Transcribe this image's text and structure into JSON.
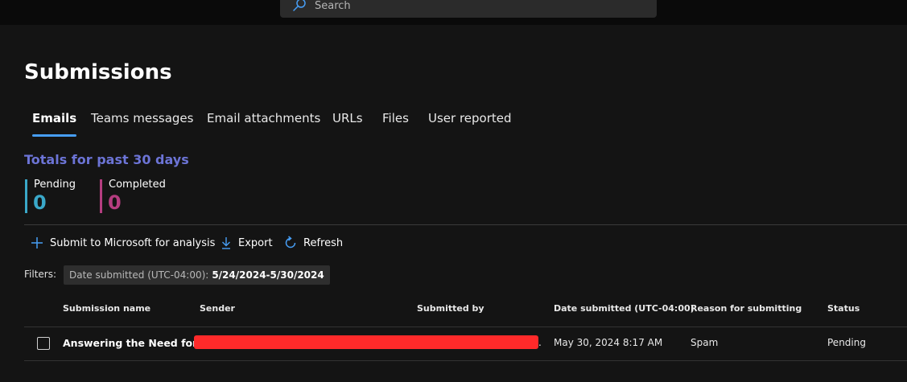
{
  "search": {
    "placeholder": "Search"
  },
  "page": {
    "title": "Submissions"
  },
  "tabs": [
    {
      "label": "Emails",
      "active": true
    },
    {
      "label": "Teams messages"
    },
    {
      "label": "Email attachments"
    },
    {
      "label": "URLs"
    },
    {
      "label": "Files"
    },
    {
      "label": "User reported"
    }
  ],
  "totals": {
    "title": "Totals for past 30 days",
    "pending": {
      "label": "Pending",
      "value": "0",
      "color": "#3aa8c9"
    },
    "completed": {
      "label": "Completed",
      "value": "0",
      "color": "#b53d80"
    }
  },
  "toolbar": {
    "submit_label": "Submit to Microsoft for analysis",
    "export_label": "Export",
    "refresh_label": "Refresh",
    "accent": "#479ef5"
  },
  "filters": {
    "label": "Filters:",
    "chip_key": "Date submitted (UTC-04:00):",
    "chip_value": "5/24/2024-5/30/2024"
  },
  "table": {
    "columns": [
      "Submission name",
      "Sender",
      "Submitted by",
      "Date submitted (UTC-04:00)",
      "Reason for submitting",
      "Status"
    ],
    "rows": [
      {
        "name": "Answering the Need for...",
        "sender": "",
        "submitted_by": "",
        "date": "May 30, 2024 8:17 AM",
        "reason": "Spam",
        "status": "Pending"
      }
    ]
  }
}
